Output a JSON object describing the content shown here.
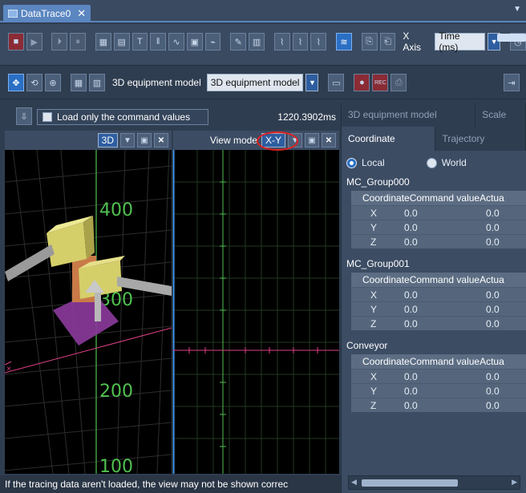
{
  "window": {
    "tab_title": "DataTrace0",
    "close_glyph": "✕"
  },
  "toolbar": {
    "x_axis_label": "X Axis",
    "x_axis_value": "Time (ms)",
    "model_label": "3D equipment model",
    "model_value": "3D equipment model",
    "rec_label": "REC"
  },
  "load_bar": {
    "checkbox_label": "Load only the command values",
    "checked": false,
    "time_readout": "1220.3902ms"
  },
  "view3d": {
    "mode_value": "3D",
    "axis_labels": [
      "400",
      "300",
      "200",
      "100"
    ]
  },
  "viewxy": {
    "label": "View mode",
    "mode_value": "X-Y"
  },
  "right_panel": {
    "top_tabs": [
      "3D equipment model",
      "Scale"
    ],
    "sub_tabs": [
      "Coordinate",
      "Trajectory"
    ],
    "radio_local": "Local",
    "radio_world": "World",
    "selected": "Local",
    "groups": [
      {
        "title": "MC_Group000",
        "header": "CoordinateCommand valueActua",
        "rows": [
          {
            "axis": "X",
            "command": "0.0",
            "actual": "0.0"
          },
          {
            "axis": "Y",
            "command": "0.0",
            "actual": "0.0"
          },
          {
            "axis": "Z",
            "command": "0.0",
            "actual": "0.0"
          }
        ]
      },
      {
        "title": "MC_Group001",
        "header": "CoordinateCommand valueActua",
        "rows": [
          {
            "axis": "X",
            "command": "0.0",
            "actual": "0.0"
          },
          {
            "axis": "Y",
            "command": "0.0",
            "actual": "0.0"
          },
          {
            "axis": "Z",
            "command": "0.0",
            "actual": "0.0"
          }
        ]
      },
      {
        "title": "Conveyor",
        "header": "CoordinateCommand valueActua",
        "rows": [
          {
            "axis": "X",
            "command": "0.0",
            "actual": "0.0"
          },
          {
            "axis": "Y",
            "command": "0.0",
            "actual": "0.0"
          },
          {
            "axis": "Z",
            "command": "0.0",
            "actual": "0.0"
          }
        ]
      }
    ]
  },
  "status": {
    "message": "If the tracing data aren't loaded, the view may not be shown correc"
  },
  "colors": {
    "accent": "#5b86c0",
    "highlight_ring": "#e02020",
    "grid_green": "#4fc24f",
    "axis_pink": "#e0408a",
    "axis_blue": "#3aa0ff"
  }
}
